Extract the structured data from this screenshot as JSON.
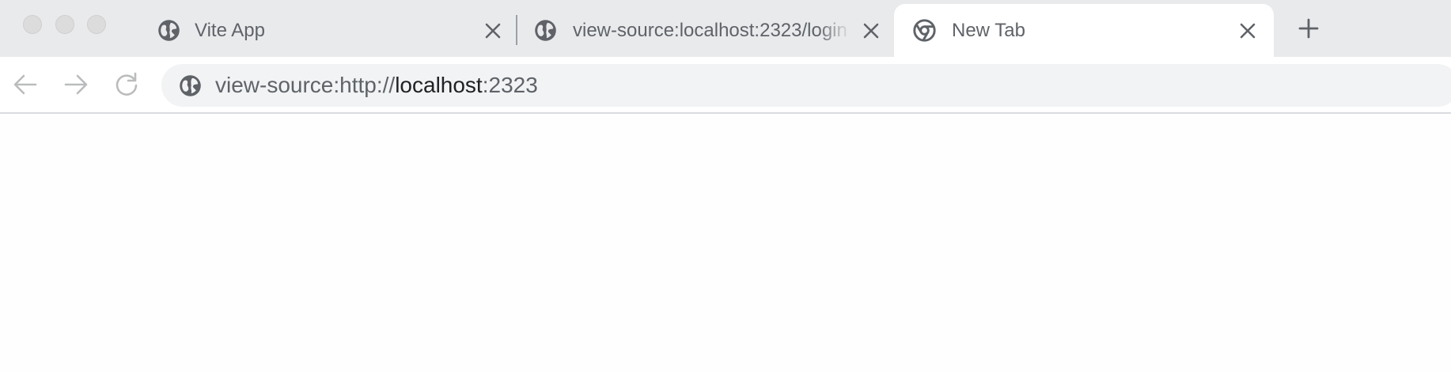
{
  "window": {
    "traffic_lights": [
      "close",
      "minimize",
      "zoom"
    ]
  },
  "tabs": [
    {
      "title": "Vite App",
      "icon": "globe-icon",
      "active": false
    },
    {
      "title": "view-source:localhost:2323/login",
      "icon": "globe-icon",
      "active": false
    },
    {
      "title": "New Tab",
      "icon": "chrome-icon",
      "active": true
    }
  ],
  "toolbar": {
    "back_icon": "arrow-left-icon",
    "forward_icon": "arrow-right-icon",
    "reload_icon": "reload-icon",
    "new_tab_icon": "plus-icon"
  },
  "omnibox": {
    "icon": "globe-icon",
    "url_prefix": "view-source:http://",
    "url_host": "localhost",
    "url_suffix": ":2323"
  },
  "colors": {
    "tabstrip": "#e9eaec",
    "omnibox": "#f1f3f4",
    "icon_gray": "#5f6368",
    "disabled_gray": "#babcbe"
  }
}
